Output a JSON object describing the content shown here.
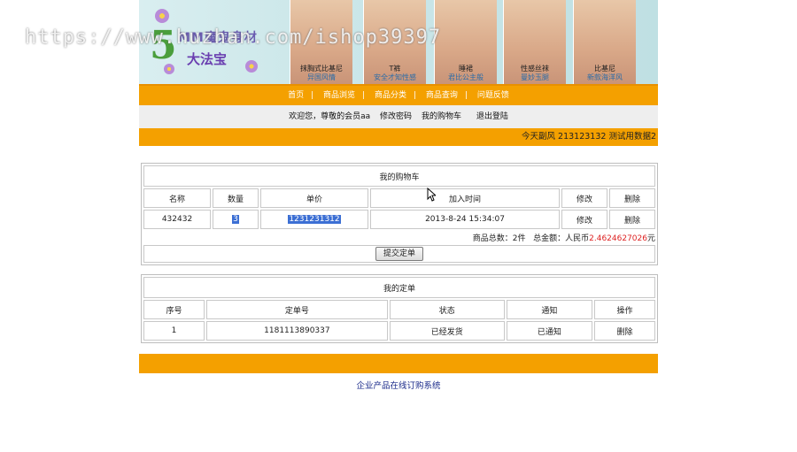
{
  "watermark": "https://www.huzhan.com/ishop39397",
  "banner": {
    "logo_five": "5",
    "logo_line1": "MM魔鬼身材",
    "logo_line2": "大法宝",
    "models": [
      {
        "l1": "抹胸式比基尼",
        "l2": "异国风情"
      },
      {
        "l1": "T裤",
        "l2": "安全才知性感"
      },
      {
        "l1": "睡裙",
        "l2": "君比公主般"
      },
      {
        "l1": "性感丝袜",
        "l2": "曼妙玉腿"
      },
      {
        "l1": "比基尼",
        "l2": "新款海洋风"
      }
    ]
  },
  "nav": {
    "items": [
      "首页",
      "商品浏览",
      "商品分类",
      "商品查询",
      "问题反馈"
    ]
  },
  "userbar": {
    "welcome": "欢迎您，尊敬的会员aa",
    "change_password": "修改密码",
    "my_cart": "我的购物车",
    "logout": "退出登陆"
  },
  "marquee": "今天副风  213123132  测试用数据2",
  "cart": {
    "title": "我的购物车",
    "headers": [
      "名称",
      "数量",
      "单价",
      "加入时间",
      "修改",
      "删除"
    ],
    "row": {
      "name": "432432",
      "qty": "3",
      "price": "1231231312",
      "time": "2013-8-24 15:34:07",
      "edit": "修改",
      "delete": "删除"
    },
    "summary_count_label": "商品总数：2件",
    "summary_total_label": "总金额：人民币",
    "summary_total_value": "2.4624627026",
    "summary_unit": "元",
    "submit": "提交定单"
  },
  "orders": {
    "title": "我的定单",
    "headers": [
      "序号",
      "定单号",
      "状态",
      "通知",
      "操作"
    ],
    "row": {
      "no": "1",
      "order_id": "1181113890337",
      "status": "已经发货",
      "notice": "已通知",
      "action": "删除"
    }
  },
  "footer": {
    "copyright": "企业产品在线订购系统"
  },
  "colors": {
    "orange": "#f4a000",
    "link_blue": "#1a2a8a",
    "select_blue": "#3c6fd4"
  }
}
